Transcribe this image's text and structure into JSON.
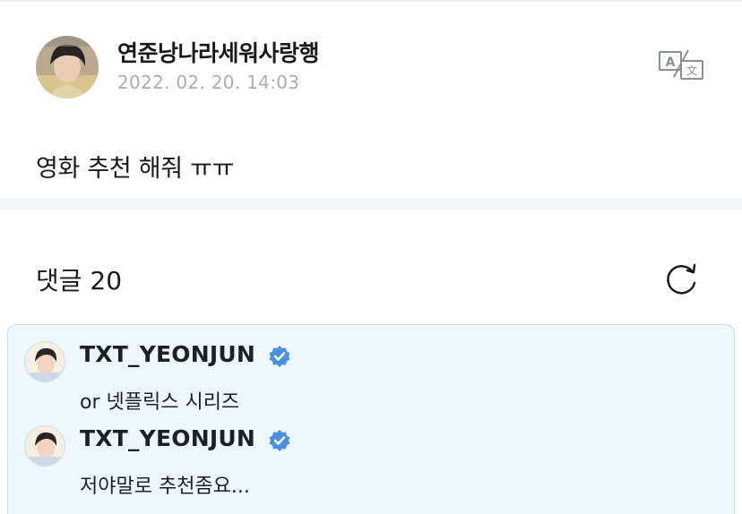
{
  "post": {
    "author_name": "연준낭나라세워사랑행",
    "date": "2022. 02. 20. 14:03",
    "body": "영화 추천 해줘 ㅠㅠ",
    "translate_icon": "translate-icon"
  },
  "comments_section": {
    "header": "댓글 20",
    "refresh_icon": "refresh-icon"
  },
  "comments": [
    {
      "author": "TXT_YEONJUN",
      "verified": true,
      "text": "or 넷플릭스 시리즈"
    },
    {
      "author": "TXT_YEONJUN",
      "verified": true,
      "text": "저야말로 추천좀요..."
    }
  ],
  "colors": {
    "verified_badge": "#4a90e2",
    "comment_panel_bg": "#eef7fd",
    "date_gray": "#a9adb3"
  }
}
